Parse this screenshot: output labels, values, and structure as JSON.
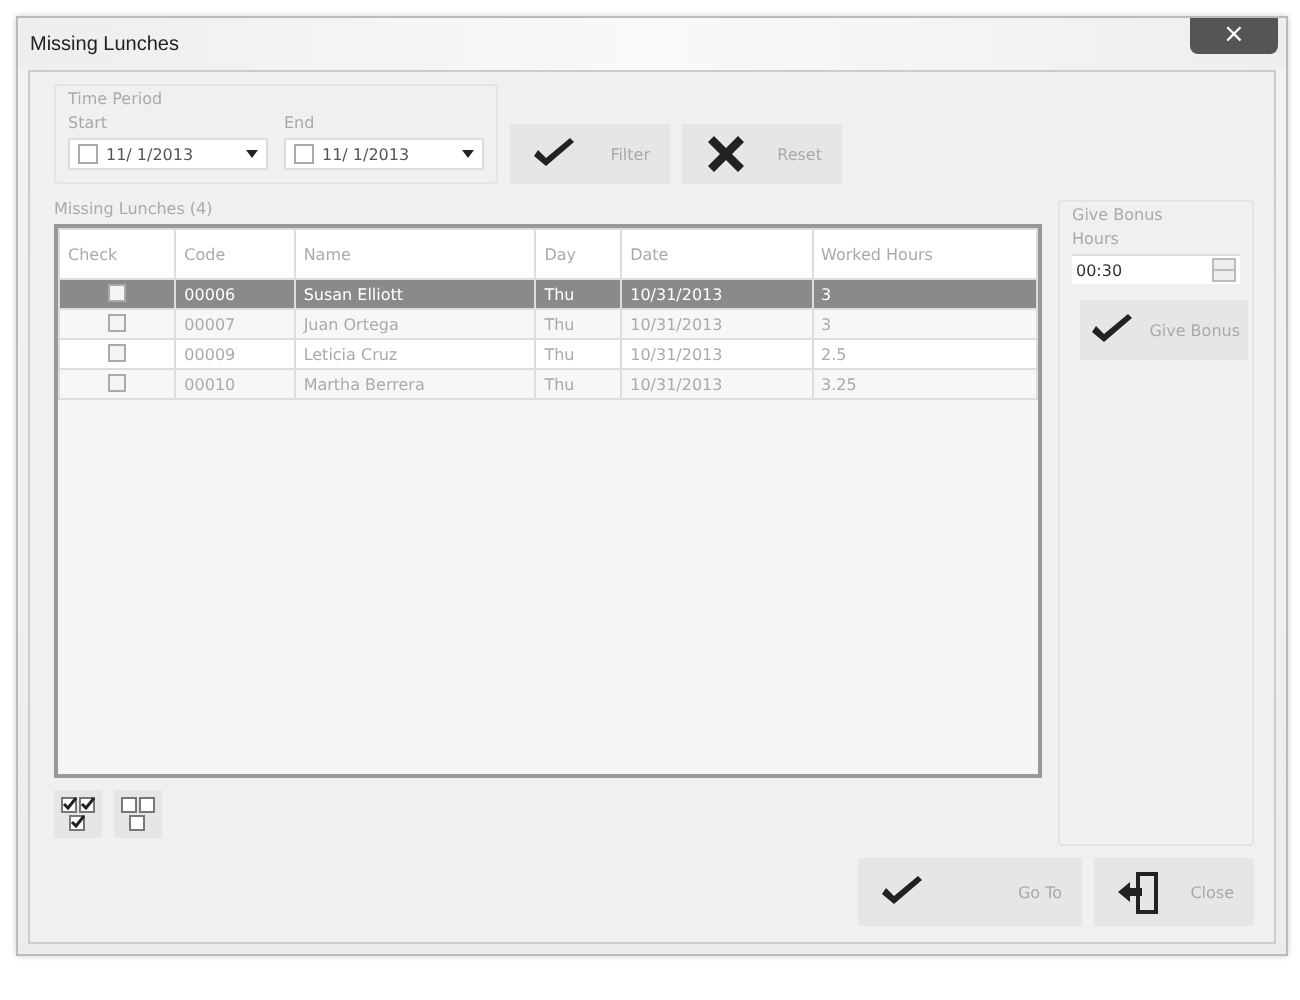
{
  "window": {
    "title": "Missing Lunches",
    "close": "×"
  },
  "time_period": {
    "title": "Time Period",
    "start": {
      "label": "Start",
      "checked": false,
      "value": "11/ 1/2013"
    },
    "end": {
      "label": "End",
      "checked": false,
      "value": "11/ 1/2013"
    }
  },
  "filter_buttons": [
    {
      "kind": "check",
      "label": "Filter"
    },
    {
      "kind": "cross",
      "label": "Reset"
    }
  ],
  "table": {
    "title": "Missing Lunches (4)",
    "columns": [
      "Check",
      "Code",
      "Name",
      "Day",
      "Date",
      "Worked Hours"
    ],
    "rows": [
      {
        "selected": true,
        "checked": false,
        "cells": [
          "",
          "00006",
          "Susan Elliott",
          "Thu",
          "10/31/2013",
          "3"
        ]
      },
      {
        "selected": false,
        "checked": false,
        "cells": [
          "",
          "00007",
          "Juan Ortega",
          "Thu",
          "10/31/2013",
          "3"
        ]
      },
      {
        "selected": false,
        "checked": false,
        "cells": [
          "",
          "00009",
          "Leticia Cruz",
          "Thu",
          "10/31/2013",
          "2.5"
        ]
      },
      {
        "selected": false,
        "checked": false,
        "cells": [
          "",
          "00010",
          "Martha Berrera",
          "Thu",
          "10/31/2013",
          "3.25"
        ]
      }
    ]
  },
  "bonus": {
    "title": "Give Bonus",
    "label": "Hours",
    "value": "00:30",
    "button": "Give Bonus"
  },
  "footer_buttons": [
    {
      "kind": "check",
      "label": "Go To"
    },
    {
      "kind": "door",
      "label": "Close"
    }
  ]
}
